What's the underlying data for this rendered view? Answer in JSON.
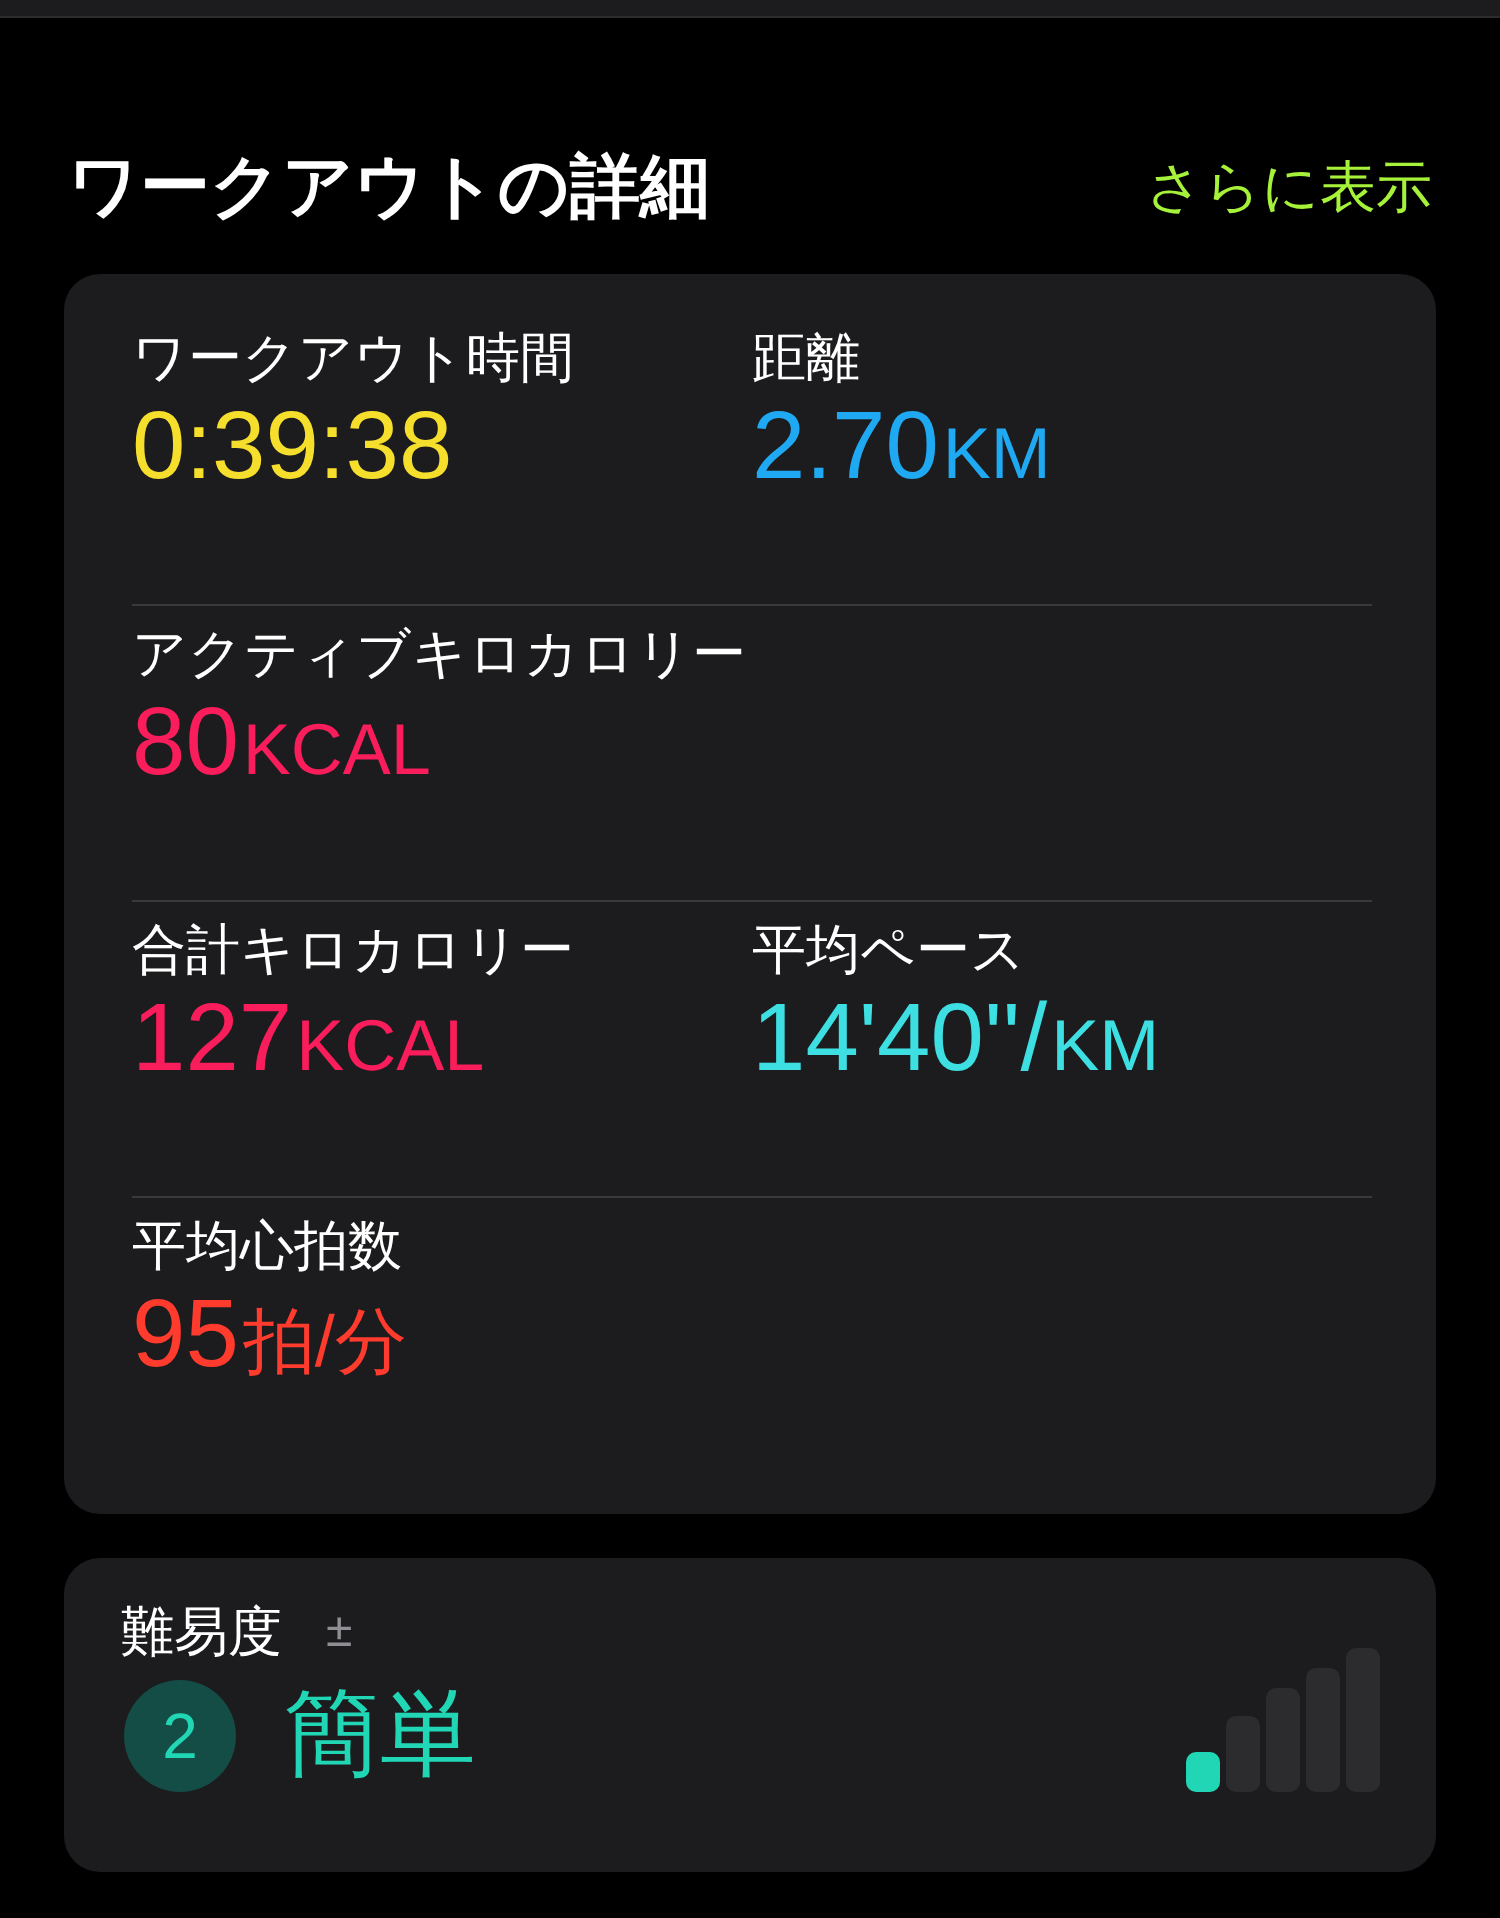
{
  "header": {
    "title": "ワークアウトの詳細",
    "more_link": "さらに表示"
  },
  "metrics": [
    [
      {
        "label": "ワークアウト時間",
        "value": "0:39:38",
        "color": "#f5de2c"
      },
      {
        "label": "距離",
        "value": "2.70",
        "unit": "KM",
        "color": "#1ea9f2"
      }
    ],
    [
      {
        "label": "アクティブキロカロリー",
        "value": "80",
        "unit": "KCAL",
        "color": "#fa1d5c"
      }
    ],
    [
      {
        "label": "合計キロカロリー",
        "value": "127",
        "unit": "KCAL",
        "color": "#fa1d5c"
      },
      {
        "label": "平均ペース",
        "value": "14'40''/",
        "unit": "KM",
        "color": "#3ddfe2"
      }
    ],
    [
      {
        "label": "平均心拍数",
        "value": "95",
        "unit": "拍/分",
        "color": "#ff3b2e"
      }
    ]
  ],
  "effort": {
    "label": "難易度",
    "adjust_symbol": "±",
    "score": "2",
    "rating": "簡単",
    "level": 0.2
  }
}
